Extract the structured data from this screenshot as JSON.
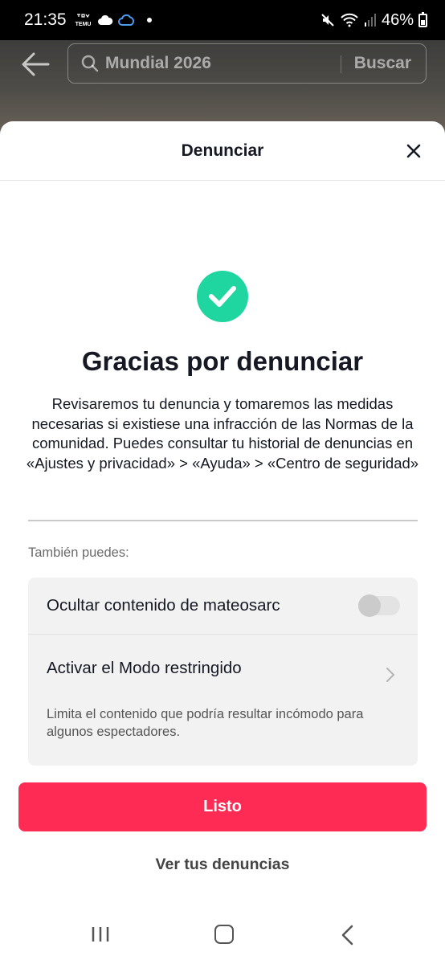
{
  "status_bar": {
    "time": "21:35",
    "notif_app": "TEMU",
    "battery": "46%",
    "battery_level": 0.46
  },
  "search": {
    "query": "Mundial 2026",
    "button_label": "Buscar"
  },
  "sheet": {
    "title": "Denunciar",
    "heading": "Gracias por denunciar",
    "description": "Revisaremos tu denuncia y tomaremos las medidas necesarias si existiese una infracción de las Normas de la comunidad. Puedes consultar tu historial de denuncias en «Ajustes y privacidad» > «Ayuda» > «Centro de seguridad»",
    "also_label": "También puedes:",
    "options": {
      "hide_label": "Ocultar contenido de mateosarc",
      "hide_enabled": false,
      "restricted_label": "Activar el Modo restringido",
      "restricted_desc": "Limita el contenido que podría resultar incómodo para algunos espectadores."
    },
    "done_label": "Listo",
    "view_reports_label": "Ver tus denuncias"
  },
  "colors": {
    "accent": "#fe2c55",
    "success": "#1fd6a0"
  }
}
